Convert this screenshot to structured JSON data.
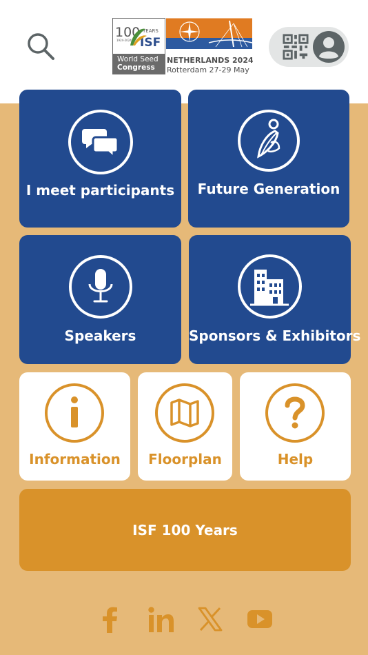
{
  "header": {
    "logo": {
      "years_number": "100",
      "years_word": "YEARS",
      "range": "1924-2024",
      "org": "ISF",
      "event_line1": "World Seed",
      "event_line2": "Congress",
      "country": "NETHERLANDS 2024",
      "location": "Rotterdam 27-29 May"
    }
  },
  "tiles": {
    "meet": {
      "label": "I meet participants",
      "icon": "chat-bubbles-icon"
    },
    "future": {
      "label": "Future Generation",
      "icon": "leaf-figure-icon"
    },
    "speakers": {
      "label": "Speakers",
      "icon": "microphone-icon"
    },
    "sponsors": {
      "label": "Sponsors & Exhibitors",
      "icon": "building-icon"
    },
    "information": {
      "label": "Information",
      "icon": "info-icon"
    },
    "floorplan": {
      "label": "Floorplan",
      "icon": "map-icon"
    },
    "help": {
      "label": "Help",
      "icon": "question-icon"
    },
    "isf100": {
      "label": "ISF 100 Years"
    }
  },
  "social": [
    "facebook-icon",
    "linkedin-icon",
    "x-icon",
    "youtube-icon"
  ],
  "colors": {
    "blue": "#224a8f",
    "gold": "#d9922a",
    "background": "#e6b978",
    "white": "#ffffff",
    "icon_gray": "#5c6466"
  }
}
